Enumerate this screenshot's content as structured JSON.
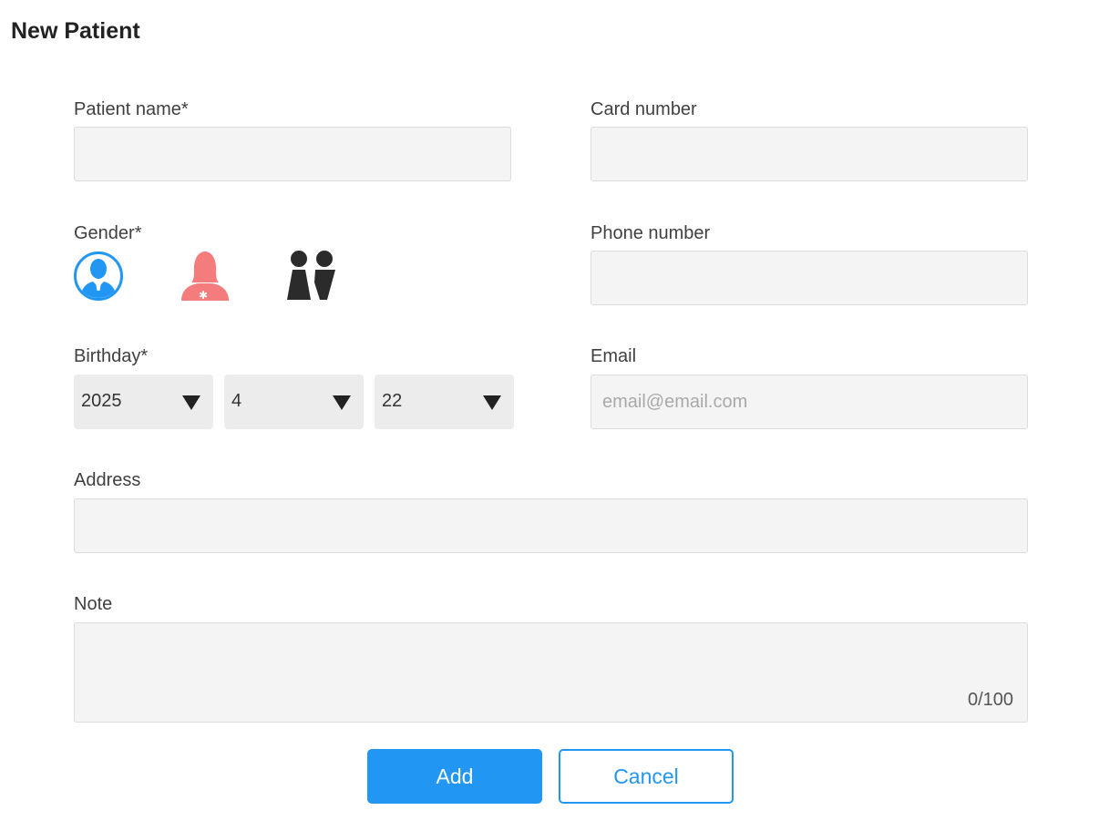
{
  "page_title": "New Patient",
  "fields": {
    "patient_name": {
      "label": "Patient name*",
      "value": "",
      "placeholder": ""
    },
    "card_number": {
      "label": "Card number",
      "value": "",
      "placeholder": ""
    },
    "gender": {
      "label": "Gender*",
      "options": [
        "male",
        "female",
        "other"
      ]
    },
    "phone_number": {
      "label": "Phone number",
      "value": "",
      "placeholder": ""
    },
    "birthday": {
      "label": "Birthday*",
      "year": "2025",
      "month": "4",
      "day": "22"
    },
    "email": {
      "label": "Email",
      "value": "",
      "placeholder": "email@email.com"
    },
    "address": {
      "label": "Address",
      "value": "",
      "placeholder": ""
    },
    "note": {
      "label": "Note",
      "value": "",
      "placeholder": "",
      "counter": "0/100"
    }
  },
  "buttons": {
    "add": "Add",
    "cancel": "Cancel"
  },
  "colors": {
    "accent": "#2196f3",
    "male_icon": "#2196f3",
    "female_icon": "#f47c7c",
    "other_icon": "#2b2b2b",
    "field_bg": "#f4f4f4"
  },
  "icons": {
    "male": "male-user-icon",
    "female": "female-user-icon",
    "other": "other-gender-icon",
    "dropdown": "chevron-down-icon"
  }
}
